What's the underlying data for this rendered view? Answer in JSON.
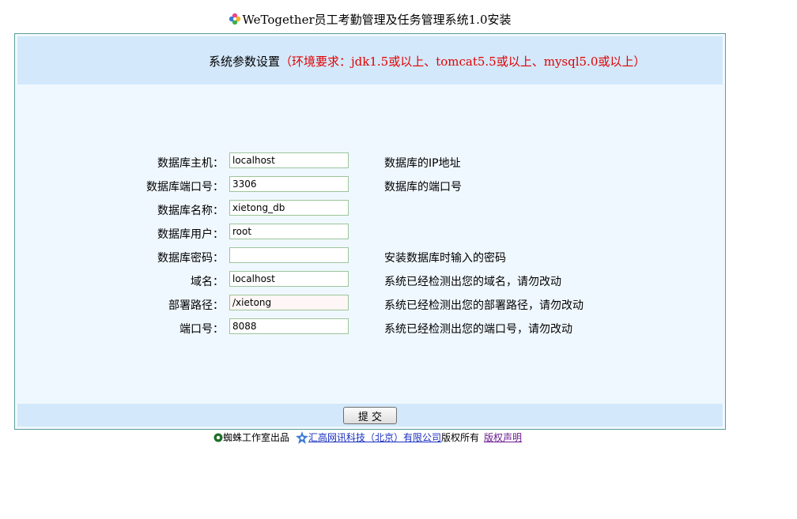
{
  "page": {
    "title": "WeTogether员工考勤管理及任务管理系统1.0安装"
  },
  "header": {
    "heading": "系统参数设置",
    "requirements": "（环境要求：jdk1.5或以上、tomcat5.5或以上、mysql5.0或以上）"
  },
  "form": {
    "fields": [
      {
        "label": "数据库主机：",
        "value": "localhost",
        "hint": "数据库的IP地址"
      },
      {
        "label": "数据库端口号：",
        "value": "3306",
        "hint": "数据库的端口号"
      },
      {
        "label": "数据库名称：",
        "value": "xietong_db",
        "hint": ""
      },
      {
        "label": "数据库用户：",
        "value": "root",
        "hint": ""
      },
      {
        "label": "数据库密码：",
        "value": "",
        "hint": "安装数据库时输入的密码"
      },
      {
        "label": "域名：",
        "value": "localhost",
        "hint": "系统已经检测出您的域名，请勿改动"
      },
      {
        "label": "部署路径：",
        "value": "/xietong",
        "hint": "系统已经检测出您的部署路径，请勿改动"
      },
      {
        "label": "端口号：",
        "value": "8088",
        "hint": "系统已经检测出您的端口号，请勿改动"
      }
    ],
    "submit_label": "提 交"
  },
  "footer": {
    "studio": "蜘蛛工作室出品",
    "company_link": "汇高网讯科技（北京）有限公司",
    "rights": "版权所有",
    "copyright_link": "版权声明"
  },
  "colors": {
    "panel_border": "#5d9e9a",
    "panel_bg": "#f0f8ff",
    "header_bg": "#d3e8fa",
    "requirement_text": "#e20000",
    "link_blue": "#1a2fc0",
    "link_visited": "#6b1a8e"
  },
  "icons": {
    "title_logo": "flower-logo-icon",
    "studio_logo": "spider-icon",
    "company_logo": "star-burst-icon"
  }
}
